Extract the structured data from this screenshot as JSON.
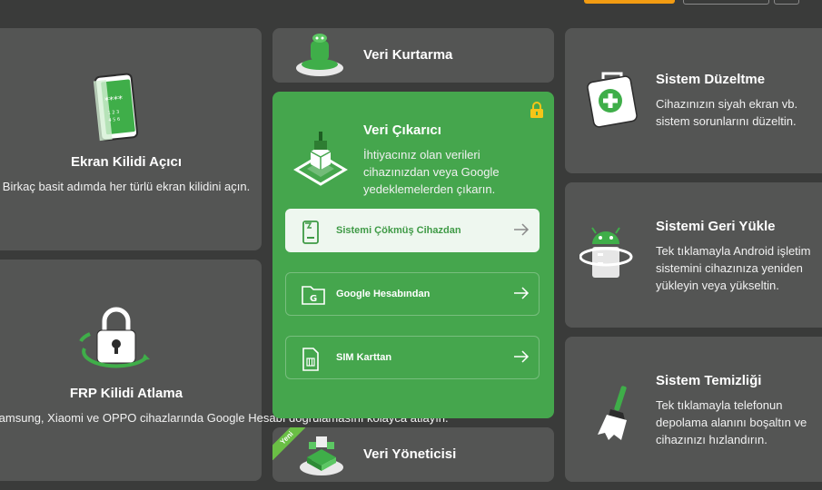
{
  "cards": {
    "screen_unlock": {
      "title": "Ekran Kilidi Açıcı",
      "desc": "Birkaç basit adımda her türlü ekran kilidini açın."
    },
    "frp": {
      "title": "FRP Kilidi Atlama",
      "desc": "Samsung, Xiaomi ve OPPO cihazlarında Google Hesabı doğrulamasını kolayca atlayın."
    },
    "data_recovery": {
      "title": "Veri Kurtarma"
    },
    "data_extractor": {
      "title": "Veri Çıkarıcı",
      "desc": "İhtiyacınız olan verileri cihazınızdan veya Google yedeklemelerden çıkarın.",
      "options": [
        {
          "label": "Sistemi Çökmüş Cihazdan",
          "icon": "crashed-phone-icon"
        },
        {
          "label": "Google Hesabından",
          "icon": "google-folder-icon"
        },
        {
          "label": "SIM Karttan",
          "icon": "sim-card-icon"
        }
      ]
    },
    "data_manager": {
      "title": "Veri Yöneticisi",
      "badge": "Yeni"
    },
    "system_repair": {
      "title": "Sistem Düzeltme",
      "desc": "Cihazınızın siyah ekran vb. sistem sorunlarını düzeltin."
    },
    "system_reinstall": {
      "title": "Sistemi Geri Yükle",
      "desc": "Tek tıklamayla Android işletim sistemini cihazınıza yeniden yükleyin veya yükseltin."
    },
    "system_cleanup": {
      "title": "Sistem Temizliği",
      "desc": "Tek tıklamayla telefonun depolama alanını boşaltın ve cihazınızı hızlandırın."
    }
  },
  "colors": {
    "background": "#3a3b3a",
    "card": "#545554",
    "accent_green": "#45a64d",
    "accent_orange": "#f39c12",
    "lock_yellow": "#f5c518"
  }
}
